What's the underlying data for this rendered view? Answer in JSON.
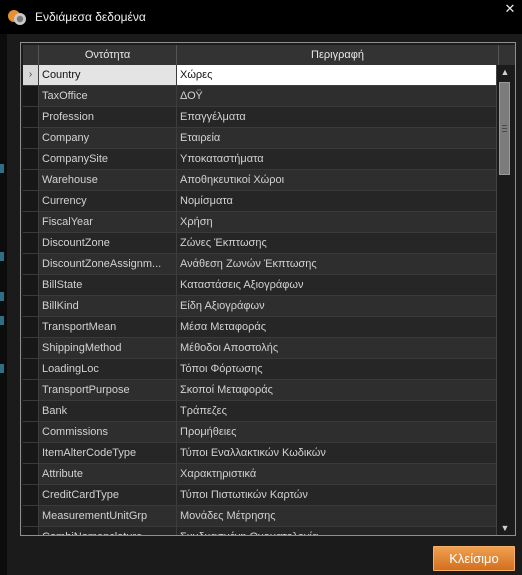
{
  "window": {
    "title": "Ενδιάμεσα δεδομένα",
    "icon": "app-logo-icon",
    "close_icon": "close-icon",
    "accent": "#e8902f"
  },
  "grid": {
    "columns": [
      "Οντότητα",
      "Περιγραφή"
    ],
    "rows": [
      {
        "entity": "Country",
        "description": "Χώρες",
        "selected": true
      },
      {
        "entity": "TaxOffice",
        "description": "ΔΟΫ"
      },
      {
        "entity": "Profession",
        "description": "Επαγγέλματα"
      },
      {
        "entity": "Company",
        "description": "Εταιρεία"
      },
      {
        "entity": "CompanySite",
        "description": "Υποκαταστήματα"
      },
      {
        "entity": "Warehouse",
        "description": "Αποθηκευτικοί Χώροι"
      },
      {
        "entity": "Currency",
        "description": "Νομίσματα"
      },
      {
        "entity": "FiscalYear",
        "description": "Χρήση"
      },
      {
        "entity": "DiscountZone",
        "description": "Ζώνες Έκπτωσης"
      },
      {
        "entity": "DiscountZoneAssignm...",
        "description": "Ανάθεση Ζωνών Έκπτωσης"
      },
      {
        "entity": "BillState",
        "description": "Καταστάσεις Αξιογράφων"
      },
      {
        "entity": "BillKind",
        "description": "Είδη Αξιογράφων"
      },
      {
        "entity": "TransportMean",
        "description": "Μέσα Μεταφοράς"
      },
      {
        "entity": "ShippingMethod",
        "description": "Μέθοδοι Αποστολής"
      },
      {
        "entity": "LoadingLoc",
        "description": "Τόποι Φόρτωσης"
      },
      {
        "entity": "TransportPurpose",
        "description": "Σκοποί Μεταφοράς"
      },
      {
        "entity": "Bank",
        "description": "Τράπεζες"
      },
      {
        "entity": "Commissions",
        "description": "Προμήθειες"
      },
      {
        "entity": "ItemAlterCodeType",
        "description": "Τύποι Εναλλακτικών Κωδικών"
      },
      {
        "entity": "Attribute",
        "description": "Χαρακτηριστικά"
      },
      {
        "entity": "CreditCardType",
        "description": "Τύποι Πιστωτικών Καρτών"
      },
      {
        "entity": "MeasurementUnitGrp",
        "description": "Μονάδες Μέτρησης"
      },
      {
        "entity": "CombiNomenclature",
        "description": "Συνδυασμένη Ονοματολογία"
      }
    ],
    "selected_row_marker": "›",
    "scroll_up_icon": "scroll-up-arrow-icon",
    "scroll_down_icon": "scroll-down-arrow-icon"
  },
  "footer": {
    "close_label": "Κλείσιμο"
  }
}
